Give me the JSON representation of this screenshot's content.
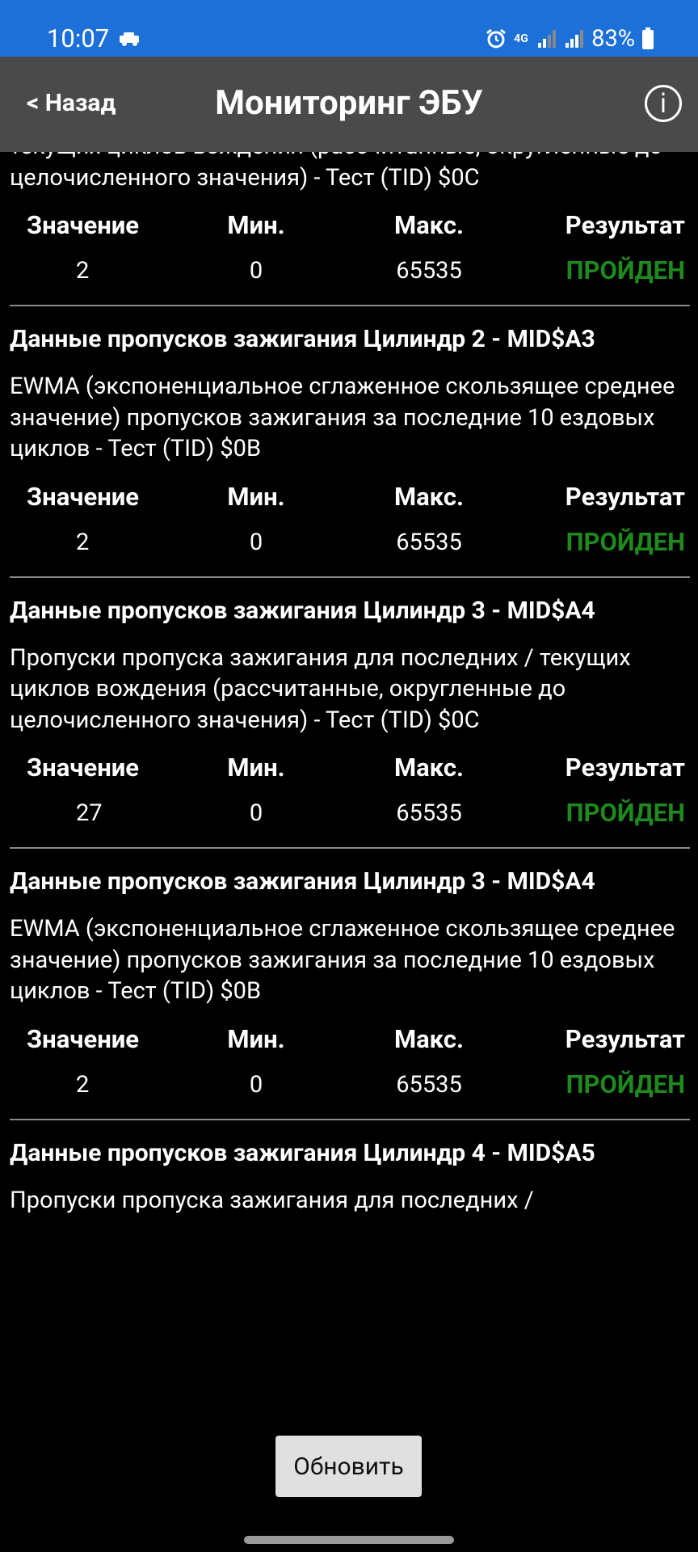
{
  "status_bar": {
    "time": "10:07",
    "network": "4G",
    "battery": "83%"
  },
  "app_bar": {
    "back_label": "< Назад",
    "title": "Мониторинг ЭБУ",
    "info_label": "i"
  },
  "columns": {
    "value": "Значение",
    "min": "Мин.",
    "max": "Макс.",
    "result": "Результат"
  },
  "entries": [
    {
      "title": "",
      "description": "текущих циклов вождения (рассчитанные, округленные до целочисленного значения) - Тест (TID) $0C",
      "value": "2",
      "min": "0",
      "max": "65535",
      "result": "ПРОЙДЕН"
    },
    {
      "title": "Данные пропусков зажигания Цилиндр 2 - MID$A3",
      "description": "EWMA (экспоненциальное сглаженное скользящее среднее значение) пропусков зажигания за последние 10 ездовых циклов - Тест (TID) $0B",
      "value": "2",
      "min": "0",
      "max": "65535",
      "result": "ПРОЙДЕН"
    },
    {
      "title": "Данные пропусков зажигания Цилиндр 3 - MID$A4",
      "description": "Пропуски пропуска зажигания для последних / текущих циклов вождения (рассчитанные, округленные до целочисленного значения) - Тест (TID) $0C",
      "value": "27",
      "min": "0",
      "max": "65535",
      "result": "ПРОЙДЕН"
    },
    {
      "title": "Данные пропусков зажигания Цилиндр 3 - MID$A4",
      "description": "EWMA (экспоненциальное сглаженное скользящее среднее значение) пропусков зажигания за последние 10 ездовых циклов - Тест (TID) $0B",
      "value": "2",
      "min": "0",
      "max": "65535",
      "result": "ПРОЙДЕН"
    },
    {
      "title": "Данные пропусков зажигания Цилиндр 4 - MID$A5",
      "description": "Пропуски пропуска зажигания для последних /",
      "value": "",
      "min": "",
      "max": "",
      "result": ""
    }
  ],
  "refresh_label": "Обновить",
  "colors": {
    "status_bar": "#1d70d8",
    "app_bar": "#4a4a4a",
    "pass": "#1e8a1e"
  }
}
